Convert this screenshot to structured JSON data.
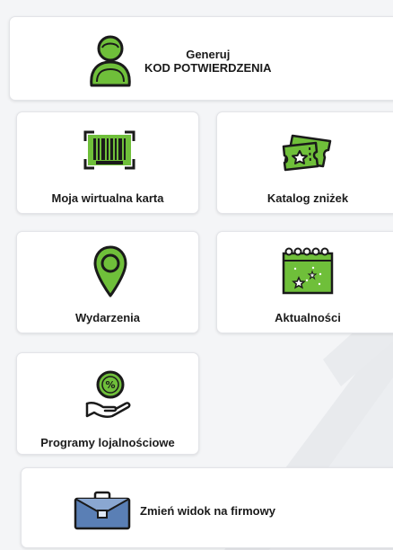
{
  "code_card": {
    "line1": "Generuj",
    "line2": "KOD POTWIERDZENIA",
    "icon": "user-badge-icon"
  },
  "tiles": {
    "virtual_card": {
      "label": "Moja wirtualna karta",
      "icon": "barcode-icon"
    },
    "discounts": {
      "label": "Katalog zniżek",
      "icon": "ticket-star-icon"
    },
    "events": {
      "label": "Wydarzenia",
      "icon": "location-pin-icon"
    },
    "news": {
      "label": "Aktualności",
      "icon": "calendar-news-icon"
    },
    "loyalty": {
      "label": "Programy lojalnościowe",
      "icon": "hand-coin-percent-icon"
    }
  },
  "switch_card": {
    "label": "Zmień widok na firmowy",
    "icon": "briefcase-icon"
  },
  "colors": {
    "accent_green": "#6fbf3a",
    "outline": "#1a1a1a",
    "briefcase_blue": "#5a7fb5",
    "background": "#f4f5f7"
  }
}
